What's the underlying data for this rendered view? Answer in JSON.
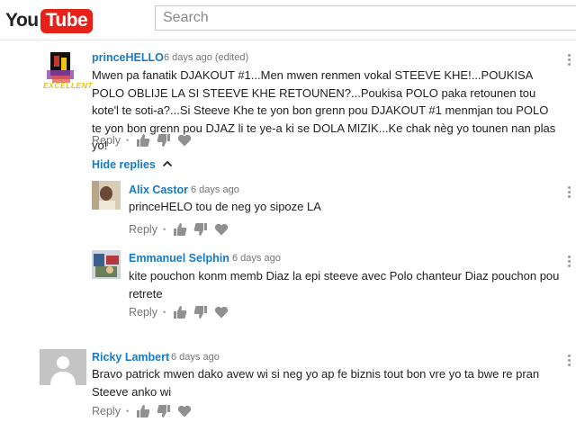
{
  "header": {
    "logo_you": "You",
    "logo_tube": "Tube",
    "search_placeholder": "Search"
  },
  "comments": [
    {
      "author": "princeHELLO",
      "time": "6 days ago (edited)",
      "text": "Mwen pa fanatik DJAKOUT #1...Men mwen renmen vokal STEEVE KHE!...POUKISA POLO OBLIJE LA SI STEEVE KHE RETOUNEN?...Poukisa POLO paka retounen tou kote'l te soti-a?...Si Steeve Khe te yon bon grenn pou DJAKOUT #1 menmjan tou POLO te yon bon grenn pou DJAZ li te ye-a ki se DOLA MIZIK...Ke chak nèg yo tounen nan plas yo!",
      "reply_label": "Reply",
      "avatar_text": "EXCELLENT"
    },
    {
      "author": "Alix Castor",
      "time": "6 days ago",
      "text": "princeHELO tou de neg yo sipoze LA",
      "reply_label": "Reply"
    },
    {
      "author": "Emmanuel Selphin",
      "time": "6 days ago",
      "text": "kite pouchon konm memb Diaz la epi steeve avec Polo chanteur Diaz pouchon pou retrete",
      "reply_label": "Reply"
    },
    {
      "author": "Ricky Lambert",
      "time": "6 days ago",
      "text": "Bravo patrick mwen dako avew wi si neg yo ap fe biznis tout bon vre yo ta bwe re pran Steeve anko wi",
      "reply_label": "Reply"
    }
  ],
  "hide_replies_label": "Hide replies",
  "icons": {
    "thumb_up": "thumbs-up-icon",
    "thumb_down": "thumbs-down-icon",
    "heart": "heart-icon",
    "more": "more-vertical-icon",
    "chevron": "chevron-up-icon"
  },
  "colors": {
    "link": "#167ac6",
    "meta": "#767676",
    "brand_red": "#e62117"
  }
}
